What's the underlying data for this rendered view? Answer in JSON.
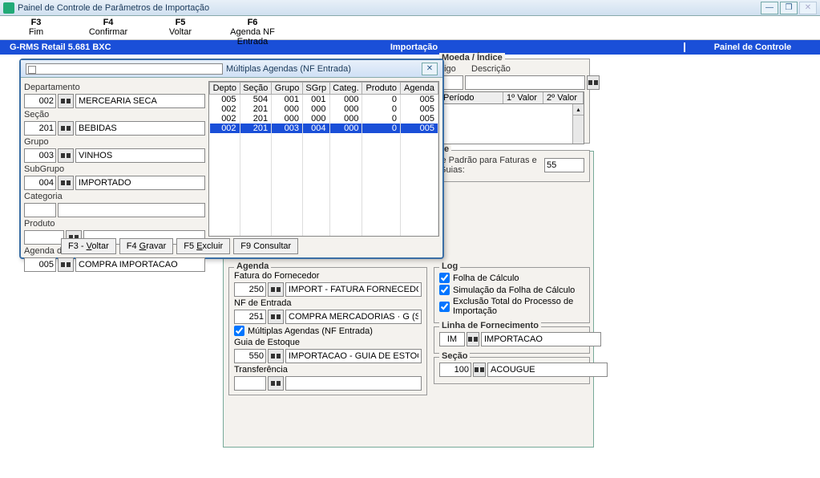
{
  "window": {
    "title": "Painel de Controle de Parâmetros de Importação",
    "min": "—",
    "restore": "❐",
    "close": "✕"
  },
  "fnkeys": [
    {
      "key": "F3",
      "label": "Fim"
    },
    {
      "key": "F4",
      "label": "Confirmar"
    },
    {
      "key": "F5",
      "label": "Voltar"
    },
    {
      "key": "F6",
      "label": "Agenda NF Entrada"
    }
  ],
  "bluebar": {
    "left": "G-RMS Retail 5.681 BXC",
    "mid": "Importação",
    "right": "Painel de Controle"
  },
  "modal": {
    "title": "Múltiplas Agendas (NF Entrada)",
    "close": "✕",
    "left": {
      "departamento_lbl": "Departamento",
      "departamento_code": "002",
      "departamento_txt": "MERCEARIA SECA",
      "secao_lbl": "Seção",
      "secao_code": "201",
      "secao_txt": "BEBIDAS",
      "grupo_lbl": "Grupo",
      "grupo_code": "003",
      "grupo_txt": "VINHOS",
      "subgrupo_lbl": "SubGrupo",
      "subgrupo_code": "004",
      "subgrupo_txt": "IMPORTADO",
      "categoria_lbl": "Categoria",
      "categoria_code": "",
      "categoria_txt": "",
      "produto_lbl": "Produto",
      "produto_code": "",
      "produto_txt": "",
      "agenda_lbl": "Agenda de Entrada",
      "agenda_code": "005",
      "agenda_txt": "COMPRA IMPORTACAO"
    },
    "grid": {
      "headers": [
        "Depto",
        "Seção",
        "Grupo",
        "SGrp",
        "Categ.",
        "Produto",
        "Agenda"
      ],
      "rows": [
        [
          "005",
          "504",
          "001",
          "001",
          "000",
          "0",
          "005"
        ],
        [
          "002",
          "201",
          "000",
          "000",
          "000",
          "0",
          "005"
        ],
        [
          "002",
          "201",
          "000",
          "000",
          "000",
          "0",
          "005"
        ],
        [
          "002",
          "201",
          "003",
          "004",
          "000",
          "0",
          "005"
        ]
      ],
      "selected_index": 3
    },
    "buttons": {
      "f3": "F3 - Voltar",
      "f4": "F4 Gravar",
      "f5": "F5 Excluir",
      "f9": "F9 Consultar",
      "f4_u": "G",
      "f5_u": "E"
    }
  },
  "bg": {
    "moeda_title": "Moeda / Índice",
    "codigo_lbl": "Código",
    "descricao_lbl": "Descrição",
    "list_headers": [
      "Período",
      "1º Valor",
      "2º Valor"
    ],
    "serie_title": "Série",
    "serie_lbl": "Série Padrão para Faturas e Guias:",
    "serie_val": "55",
    "agenda_title": "Agenda",
    "fatura_lbl": "Fatura do Fornecedor",
    "fatura_code": "250",
    "fatura_txt": "IMPORT - FATURA FORNECEDOR",
    "nf_lbl": "NF de Entrada",
    "nf_code": "251",
    "nf_txt": "COMPRA MERCADORIAS · G (S_CP)",
    "multi_lbl": "Múltiplas Agendas (NF Entrada)",
    "guia_lbl": "Guia de Estoque",
    "guia_code": "550",
    "guia_txt": "IMPORTACAO - GUIA DE ESTOQUE",
    "transf_lbl": "Transferência",
    "transf_code": "",
    "transf_txt": "",
    "log_title": "Log",
    "log1": "Folha de Cálculo",
    "log2": "Simulação da  Folha de Cálculo",
    "log3": "Exclusão Total do Processo de Importação",
    "linha_title": "Linha de Fornecimento",
    "linha_code": "IM",
    "linha_txt": "IMPORTACAO",
    "secao_title": "Seção",
    "secao_code": "100",
    "secao_txt": "ACOUGUE"
  }
}
